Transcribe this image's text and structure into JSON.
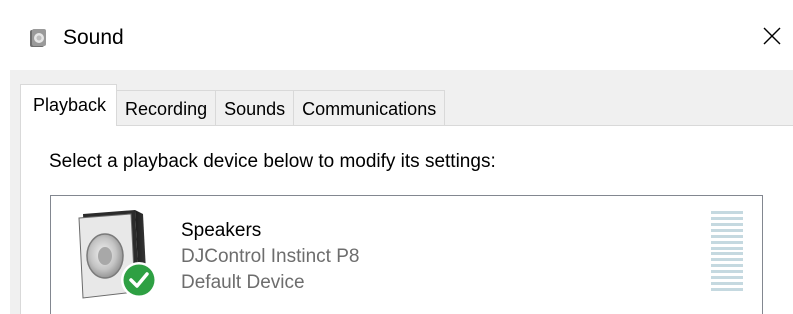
{
  "window": {
    "title": "Sound",
    "icon": "speaker-icon",
    "close_icon": "close-icon"
  },
  "tabs": [
    {
      "label": "Playback",
      "active": true
    },
    {
      "label": "Recording",
      "active": false
    },
    {
      "label": "Sounds",
      "active": false
    },
    {
      "label": "Communications",
      "active": false
    }
  ],
  "playback": {
    "instruction": "Select a playback device below to modify its settings:",
    "devices": [
      {
        "name": "Speakers",
        "description": "DJControl Instinct P8",
        "status": "Default Device",
        "icon": "speaker-device-icon",
        "badge_icon": "default-check-icon",
        "level": 0
      }
    ]
  },
  "colors": {
    "dialog_background": "#f0f0f0",
    "panel_background": "#ffffff",
    "secondary_text": "#6d6d6d",
    "check_badge": "#2ea043",
    "meter_idle": "#c5d9e0"
  }
}
